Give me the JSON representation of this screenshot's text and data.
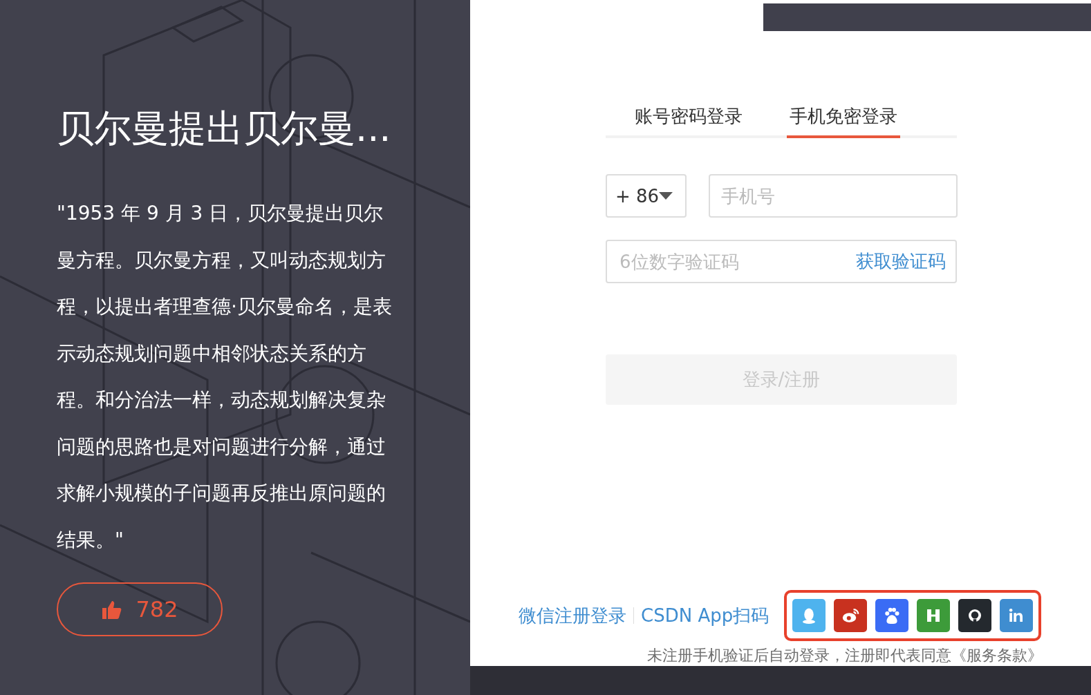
{
  "article": {
    "title": "贝尔曼提出贝尔曼...",
    "quote": "\"1953 年 9 月 3 日，贝尔曼提出贝尔曼方程。贝尔曼方程，又叫动态规划方程，以提出者理查德·贝尔曼命名，是表示动态规划问题中相邻状态关系的方程。和分治法一样，动态规划解决复杂问题的思路也是对问题进行分解，通过求解小规模的子问题再反推出原问题的结果。\"",
    "likes": "782"
  },
  "login": {
    "tabs": [
      {
        "label": "账号密码登录",
        "selected": false
      },
      {
        "label": "手机免密登录",
        "selected": true
      }
    ],
    "country_code": "+ 86",
    "phone": {
      "placeholder": "手机号"
    },
    "code": {
      "placeholder": "6位数字验证码"
    },
    "get_code": "获取验证码",
    "submit": "登录/注册",
    "alt_links": [
      "微信注册登录",
      "CSDN App扫码"
    ],
    "social": [
      {
        "kind": "qq",
        "color": "#4eb3ee"
      },
      {
        "kind": "weibo",
        "color": "#c8311f"
      },
      {
        "kind": "baidu",
        "color": "#3a6cf5"
      },
      {
        "kind": "huawei",
        "color": "#3d9b3a"
      },
      {
        "kind": "github",
        "color": "#24292e"
      },
      {
        "kind": "linkedin",
        "color": "#3f8dd0"
      }
    ],
    "notice": "未注册手机验证后自动登录，注册即代表同意《服务条款》"
  }
}
